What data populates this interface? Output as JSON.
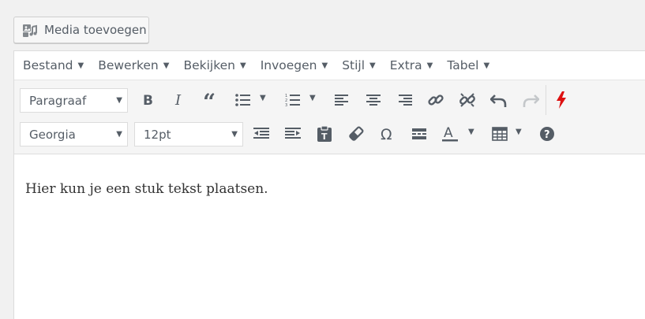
{
  "media_button": {
    "label": "Media toevoegen",
    "icon": "add-media-icon"
  },
  "menubar": {
    "items": [
      {
        "label": "Bestand"
      },
      {
        "label": "Bewerken"
      },
      {
        "label": "Bekijken"
      },
      {
        "label": "Invoegen"
      },
      {
        "label": "Stijl"
      },
      {
        "label": "Extra"
      },
      {
        "label": "Tabel"
      }
    ]
  },
  "toolbar": {
    "format_select": {
      "value": "Paragraaf"
    },
    "font_select": {
      "value": "Georgia"
    },
    "size_select": {
      "value": "12pt"
    },
    "accent_color": "#dd1111"
  },
  "editor": {
    "content": "Hier kun je een stuk tekst plaatsen."
  }
}
